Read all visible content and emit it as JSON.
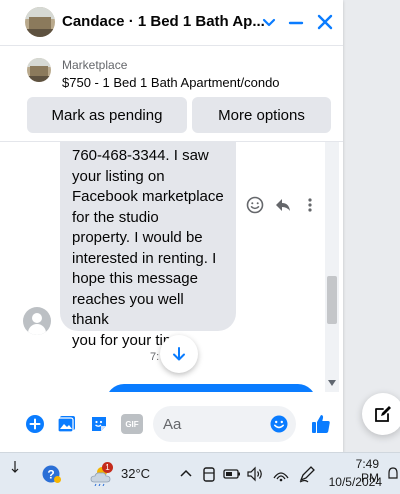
{
  "header": {
    "title": "Candace · 1 Bed 1 Bath Ap...",
    "chevron_icon": "chevron-down-icon",
    "minimize_icon": "minimize-icon",
    "close_icon": "close-icon"
  },
  "marketplace": {
    "label": "Marketplace",
    "listing": "$750 - 1 Bed 1 Bath Apartment/condo",
    "buttons": {
      "pending": "Mark as pending",
      "more": "More options"
    }
  },
  "conversation": {
    "message_lines": [
      "760-468-3344. I saw",
      "your listing on",
      "Facebook marketplace",
      "for the studio",
      "property. I would be",
      "interested in renting. I",
      "hope this message",
      "reaches you well thank",
      "you for your time."
    ],
    "timestamp_fragment": "7:",
    "message_actions": [
      "react-icon",
      "reply-icon",
      "more-icon"
    ]
  },
  "composer": {
    "placeholder": "Aa",
    "icons": [
      "add-icon",
      "photo-icon",
      "sticker-icon",
      "gif-icon",
      "emoji-icon",
      "like-icon"
    ],
    "gif_label": "GIF"
  },
  "taskbar": {
    "temperature": "32°C",
    "weather_badge": "1",
    "time": "7:49 PM",
    "date": "10/5/2024"
  },
  "colors": {
    "accent": "#0a7cff",
    "bubble": "#e4e6eb"
  }
}
